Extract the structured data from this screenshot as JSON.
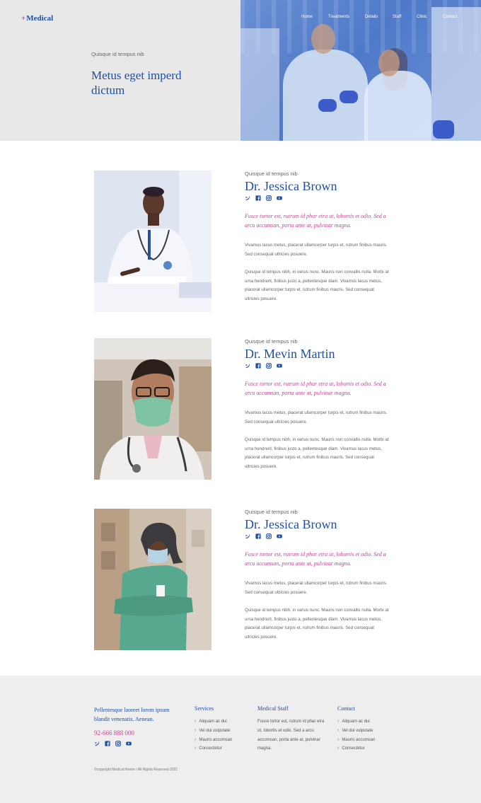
{
  "brand": {
    "logo_symbol": "+",
    "logo_text": "Medical",
    "accent": "#c2478f",
    "primary": "#1f4fa3"
  },
  "nav": {
    "items": [
      "Home",
      "Treatments",
      "Details",
      "Staff",
      "Clinic",
      "Contact"
    ]
  },
  "hero": {
    "kicker": "Quisque id tempus nib",
    "title": "Metus eget imperd dictum"
  },
  "doctors": [
    {
      "kicker": "Quisque id tempus nib",
      "name": "Dr. Jessica Brown",
      "quote": "Fusce tortor est, rutrum id phar etra ut, lobortis et odio. Sed a arcu accumsan, porta ante at, pulvinar magna.",
      "para1": "Vivamus lacus metus, placerat ullamcorper turpis et, rutrum finibus mauris. Sed consequat ultricies posuere.",
      "para2": "Quisque id tempus nibh, in varius nunc. Mauris non convallis nulla. Morbi at urna hendrerit, finibus justo a, pellentesque diam. Vivamus lacus metus, placerat ullamcorper turpis et, rutrum finibus mauris. Sed consequat ultricies posuere."
    },
    {
      "kicker": "Quisque id tempus nib",
      "name": "Dr. Mevin Martin",
      "quote": "Fusce tortor est, rutrum id phar etra ut, lobortis et odio. Sed a arcu accumsan, porta ante at, pulvinar magna.",
      "para1": "Vivamus lacus metus, placerat ullamcorper turpis et, rutrum finibus mauris. Sed consequat ultricies posuere.",
      "para2": "Quisque id tempus nibh, in varius nunc. Mauris non convallis nulla. Morbi at urna hendrerit, finibus justo a, pellentesque diam. Vivamus lacus metus, placerat ullamcorper turpis et, rutrum finibus mauris. Sed consequat ultricies posuere."
    },
    {
      "kicker": "Quisque id tempus nib",
      "name": "Dr. Jessica Brown",
      "quote": "Fusce tortor est, rutrum id phar etra ut, lobortis et odio. Sed a arcu accumsan, porta ante at, pulvinar magna.",
      "para1": "Vivamus lacus metus, placerat ullamcorper turpis et, rutrum finibus mauris. Sed consequat ultricies posuere.",
      "para2": "Quisque id tempus nibh, in varius nunc. Mauris non convallis nulla. Morbi at urna hendrerit, finibus justo a, pellentesque diam. Vivamus lacus metus, placerat ullamcorper turpis et, rutrum finibus mauris. Sed consequat ultricies posuere."
    }
  ],
  "social_icons": [
    "twitter-icon",
    "facebook-icon",
    "instagram-icon",
    "youtube-icon"
  ],
  "footer": {
    "tagline": "Pellentesque laoreet lorem ipsum blandit venenatis. Aenean.",
    "phone": "92-666 888 000",
    "services": {
      "heading": "Services",
      "items": [
        "Aliquam ac dui",
        "Vel dui vulputate",
        "Mauris accumsan",
        "Consectetur"
      ]
    },
    "staff": {
      "heading": "Medical Staff",
      "text": "Fusce tortor est, rutrum id phar etra ut, lobortis et odio. Sed a arcu accumsan, porta ante at, pulvinar magna."
    },
    "contact": {
      "heading": "Contact",
      "items": [
        "Aliquam ac dui",
        "Vel dui vulputate",
        "Mauris accumsan",
        "Consectetur"
      ]
    },
    "copyright": "©copyright Medical theme / All Rights Reserved 2021"
  }
}
